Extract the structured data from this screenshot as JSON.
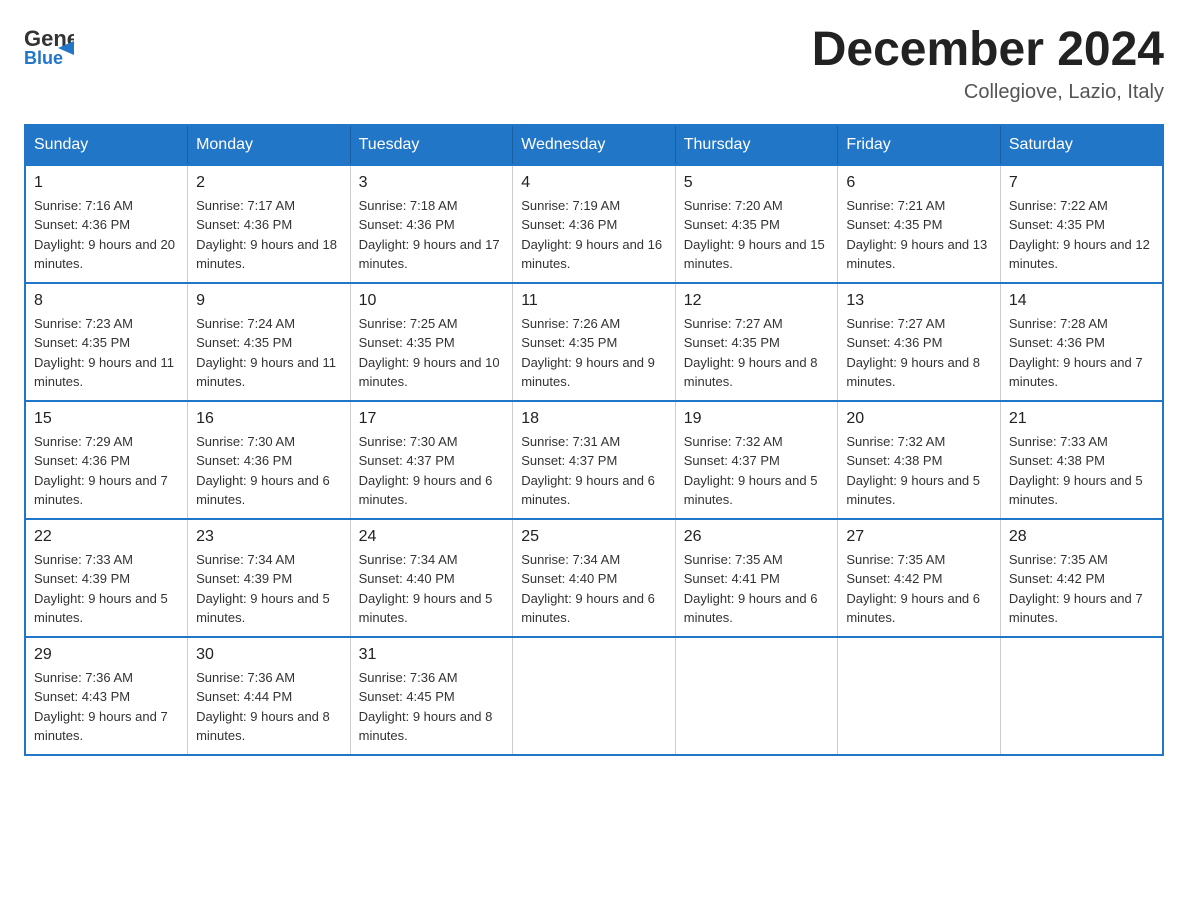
{
  "header": {
    "logo_general": "General",
    "logo_blue": "Blue",
    "month_title": "December 2024",
    "location": "Collegiove, Lazio, Italy"
  },
  "weekdays": [
    "Sunday",
    "Monday",
    "Tuesday",
    "Wednesday",
    "Thursday",
    "Friday",
    "Saturday"
  ],
  "weeks": [
    [
      {
        "day": "1",
        "sunrise": "7:16 AM",
        "sunset": "4:36 PM",
        "daylight": "9 hours and 20 minutes."
      },
      {
        "day": "2",
        "sunrise": "7:17 AM",
        "sunset": "4:36 PM",
        "daylight": "9 hours and 18 minutes."
      },
      {
        "day": "3",
        "sunrise": "7:18 AM",
        "sunset": "4:36 PM",
        "daylight": "9 hours and 17 minutes."
      },
      {
        "day": "4",
        "sunrise": "7:19 AM",
        "sunset": "4:36 PM",
        "daylight": "9 hours and 16 minutes."
      },
      {
        "day": "5",
        "sunrise": "7:20 AM",
        "sunset": "4:35 PM",
        "daylight": "9 hours and 15 minutes."
      },
      {
        "day": "6",
        "sunrise": "7:21 AM",
        "sunset": "4:35 PM",
        "daylight": "9 hours and 13 minutes."
      },
      {
        "day": "7",
        "sunrise": "7:22 AM",
        "sunset": "4:35 PM",
        "daylight": "9 hours and 12 minutes."
      }
    ],
    [
      {
        "day": "8",
        "sunrise": "7:23 AM",
        "sunset": "4:35 PM",
        "daylight": "9 hours and 11 minutes."
      },
      {
        "day": "9",
        "sunrise": "7:24 AM",
        "sunset": "4:35 PM",
        "daylight": "9 hours and 11 minutes."
      },
      {
        "day": "10",
        "sunrise": "7:25 AM",
        "sunset": "4:35 PM",
        "daylight": "9 hours and 10 minutes."
      },
      {
        "day": "11",
        "sunrise": "7:26 AM",
        "sunset": "4:35 PM",
        "daylight": "9 hours and 9 minutes."
      },
      {
        "day": "12",
        "sunrise": "7:27 AM",
        "sunset": "4:35 PM",
        "daylight": "9 hours and 8 minutes."
      },
      {
        "day": "13",
        "sunrise": "7:27 AM",
        "sunset": "4:36 PM",
        "daylight": "9 hours and 8 minutes."
      },
      {
        "day": "14",
        "sunrise": "7:28 AM",
        "sunset": "4:36 PM",
        "daylight": "9 hours and 7 minutes."
      }
    ],
    [
      {
        "day": "15",
        "sunrise": "7:29 AM",
        "sunset": "4:36 PM",
        "daylight": "9 hours and 7 minutes."
      },
      {
        "day": "16",
        "sunrise": "7:30 AM",
        "sunset": "4:36 PM",
        "daylight": "9 hours and 6 minutes."
      },
      {
        "day": "17",
        "sunrise": "7:30 AM",
        "sunset": "4:37 PM",
        "daylight": "9 hours and 6 minutes."
      },
      {
        "day": "18",
        "sunrise": "7:31 AM",
        "sunset": "4:37 PM",
        "daylight": "9 hours and 6 minutes."
      },
      {
        "day": "19",
        "sunrise": "7:32 AM",
        "sunset": "4:37 PM",
        "daylight": "9 hours and 5 minutes."
      },
      {
        "day": "20",
        "sunrise": "7:32 AM",
        "sunset": "4:38 PM",
        "daylight": "9 hours and 5 minutes."
      },
      {
        "day": "21",
        "sunrise": "7:33 AM",
        "sunset": "4:38 PM",
        "daylight": "9 hours and 5 minutes."
      }
    ],
    [
      {
        "day": "22",
        "sunrise": "7:33 AM",
        "sunset": "4:39 PM",
        "daylight": "9 hours and 5 minutes."
      },
      {
        "day": "23",
        "sunrise": "7:34 AM",
        "sunset": "4:39 PM",
        "daylight": "9 hours and 5 minutes."
      },
      {
        "day": "24",
        "sunrise": "7:34 AM",
        "sunset": "4:40 PM",
        "daylight": "9 hours and 5 minutes."
      },
      {
        "day": "25",
        "sunrise": "7:34 AM",
        "sunset": "4:40 PM",
        "daylight": "9 hours and 6 minutes."
      },
      {
        "day": "26",
        "sunrise": "7:35 AM",
        "sunset": "4:41 PM",
        "daylight": "9 hours and 6 minutes."
      },
      {
        "day": "27",
        "sunrise": "7:35 AM",
        "sunset": "4:42 PM",
        "daylight": "9 hours and 6 minutes."
      },
      {
        "day": "28",
        "sunrise": "7:35 AM",
        "sunset": "4:42 PM",
        "daylight": "9 hours and 7 minutes."
      }
    ],
    [
      {
        "day": "29",
        "sunrise": "7:36 AM",
        "sunset": "4:43 PM",
        "daylight": "9 hours and 7 minutes."
      },
      {
        "day": "30",
        "sunrise": "7:36 AM",
        "sunset": "4:44 PM",
        "daylight": "9 hours and 8 minutes."
      },
      {
        "day": "31",
        "sunrise": "7:36 AM",
        "sunset": "4:45 PM",
        "daylight": "9 hours and 8 minutes."
      },
      null,
      null,
      null,
      null
    ]
  ]
}
